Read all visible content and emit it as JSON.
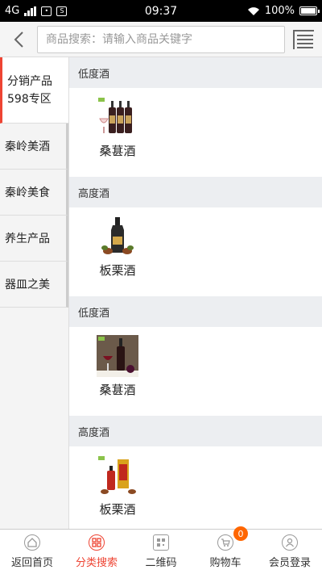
{
  "status_bar": {
    "network": "4G",
    "time": "09:37",
    "battery": "100%"
  },
  "search": {
    "placeholder": "商品搜索：请输入商品关键字"
  },
  "sidebar": {
    "items": [
      {
        "label": "分销产品598专区"
      },
      {
        "label": "秦岭美酒"
      },
      {
        "label": "秦岭美食"
      },
      {
        "label": "养生产品"
      },
      {
        "label": "器皿之美"
      }
    ]
  },
  "sections": [
    {
      "title": "低度酒",
      "product": "桑葚酒"
    },
    {
      "title": "高度酒",
      "product": "板栗酒"
    },
    {
      "title": "低度酒",
      "product": "桑葚酒"
    },
    {
      "title": "高度酒",
      "product": "板栗酒"
    }
  ],
  "tabbar": {
    "items": [
      {
        "label": "返回首页"
      },
      {
        "label": "分类搜索"
      },
      {
        "label": "二维码"
      },
      {
        "label": "购物车"
      },
      {
        "label": "会员登录"
      }
    ],
    "cart_count": "0"
  },
  "colors": {
    "accent": "#e43333",
    "badge": "#ff6600",
    "section_bg": "#eceef1"
  }
}
